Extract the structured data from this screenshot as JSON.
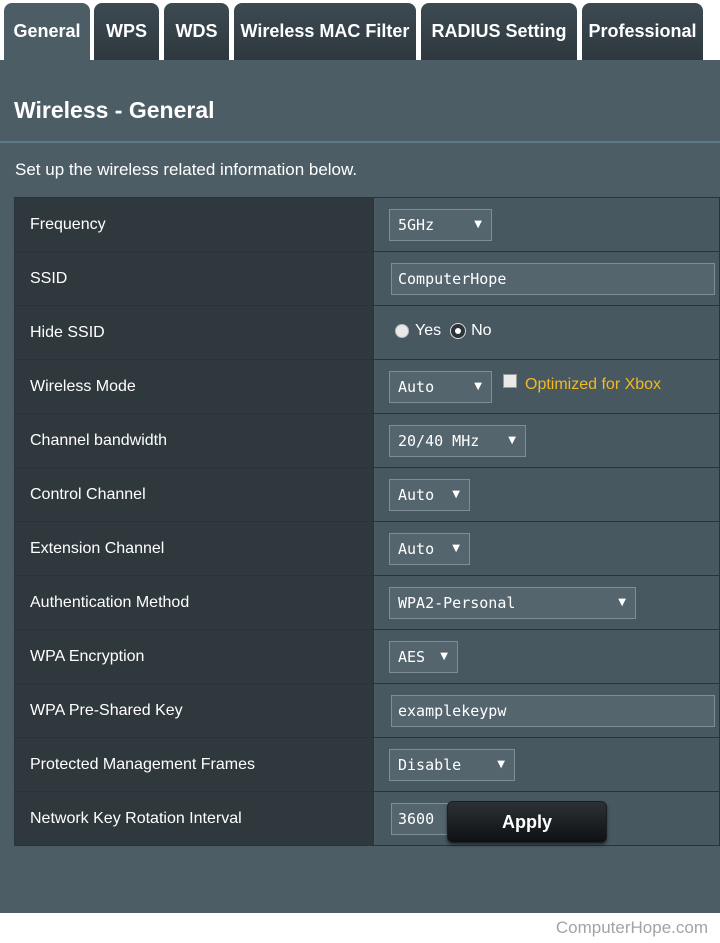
{
  "tabs": [
    {
      "label": "General",
      "active": true
    },
    {
      "label": "WPS",
      "active": false
    },
    {
      "label": "WDS",
      "active": false
    },
    {
      "label": "Wireless MAC Filter",
      "active": false
    },
    {
      "label": "RADIUS Setting",
      "active": false
    },
    {
      "label": "Professional",
      "active": false
    }
  ],
  "page": {
    "title": "Wireless - General",
    "subtitle": "Set up the wireless related information below."
  },
  "fields": {
    "frequency": {
      "label": "Frequency",
      "value": "5GHz"
    },
    "ssid": {
      "label": "SSID",
      "value": "ComputerHope"
    },
    "hide_ssid": {
      "label": "Hide SSID",
      "yes_label": "Yes",
      "no_label": "No",
      "selected": "No"
    },
    "wireless_mode": {
      "label": "Wireless Mode",
      "value": "Auto",
      "xbox_label": "Optimized for Xbox",
      "xbox_checked": false
    },
    "channel_bandwidth": {
      "label": "Channel bandwidth",
      "value": "20/40 MHz"
    },
    "control_channel": {
      "label": "Control Channel",
      "value": "Auto"
    },
    "extension_channel": {
      "label": "Extension Channel",
      "value": "Auto"
    },
    "auth_method": {
      "label": "Authentication Method",
      "value": "WPA2-Personal"
    },
    "wpa_encryption": {
      "label": "WPA Encryption",
      "value": "AES"
    },
    "wpa_psk": {
      "label": "WPA Pre-Shared Key",
      "value": "examplekeypw"
    },
    "pmf": {
      "label": "Protected Management Frames",
      "value": "Disable"
    },
    "key_rotation": {
      "label": "Network Key Rotation Interval",
      "value": "3600"
    }
  },
  "apply_label": "Apply",
  "watermark": "ComputerHope.com",
  "colors": {
    "panel": "#4d5d66",
    "label_cell": "#2f383d",
    "value_cell": "#475861",
    "xbox_accent": "#f5b81d"
  }
}
